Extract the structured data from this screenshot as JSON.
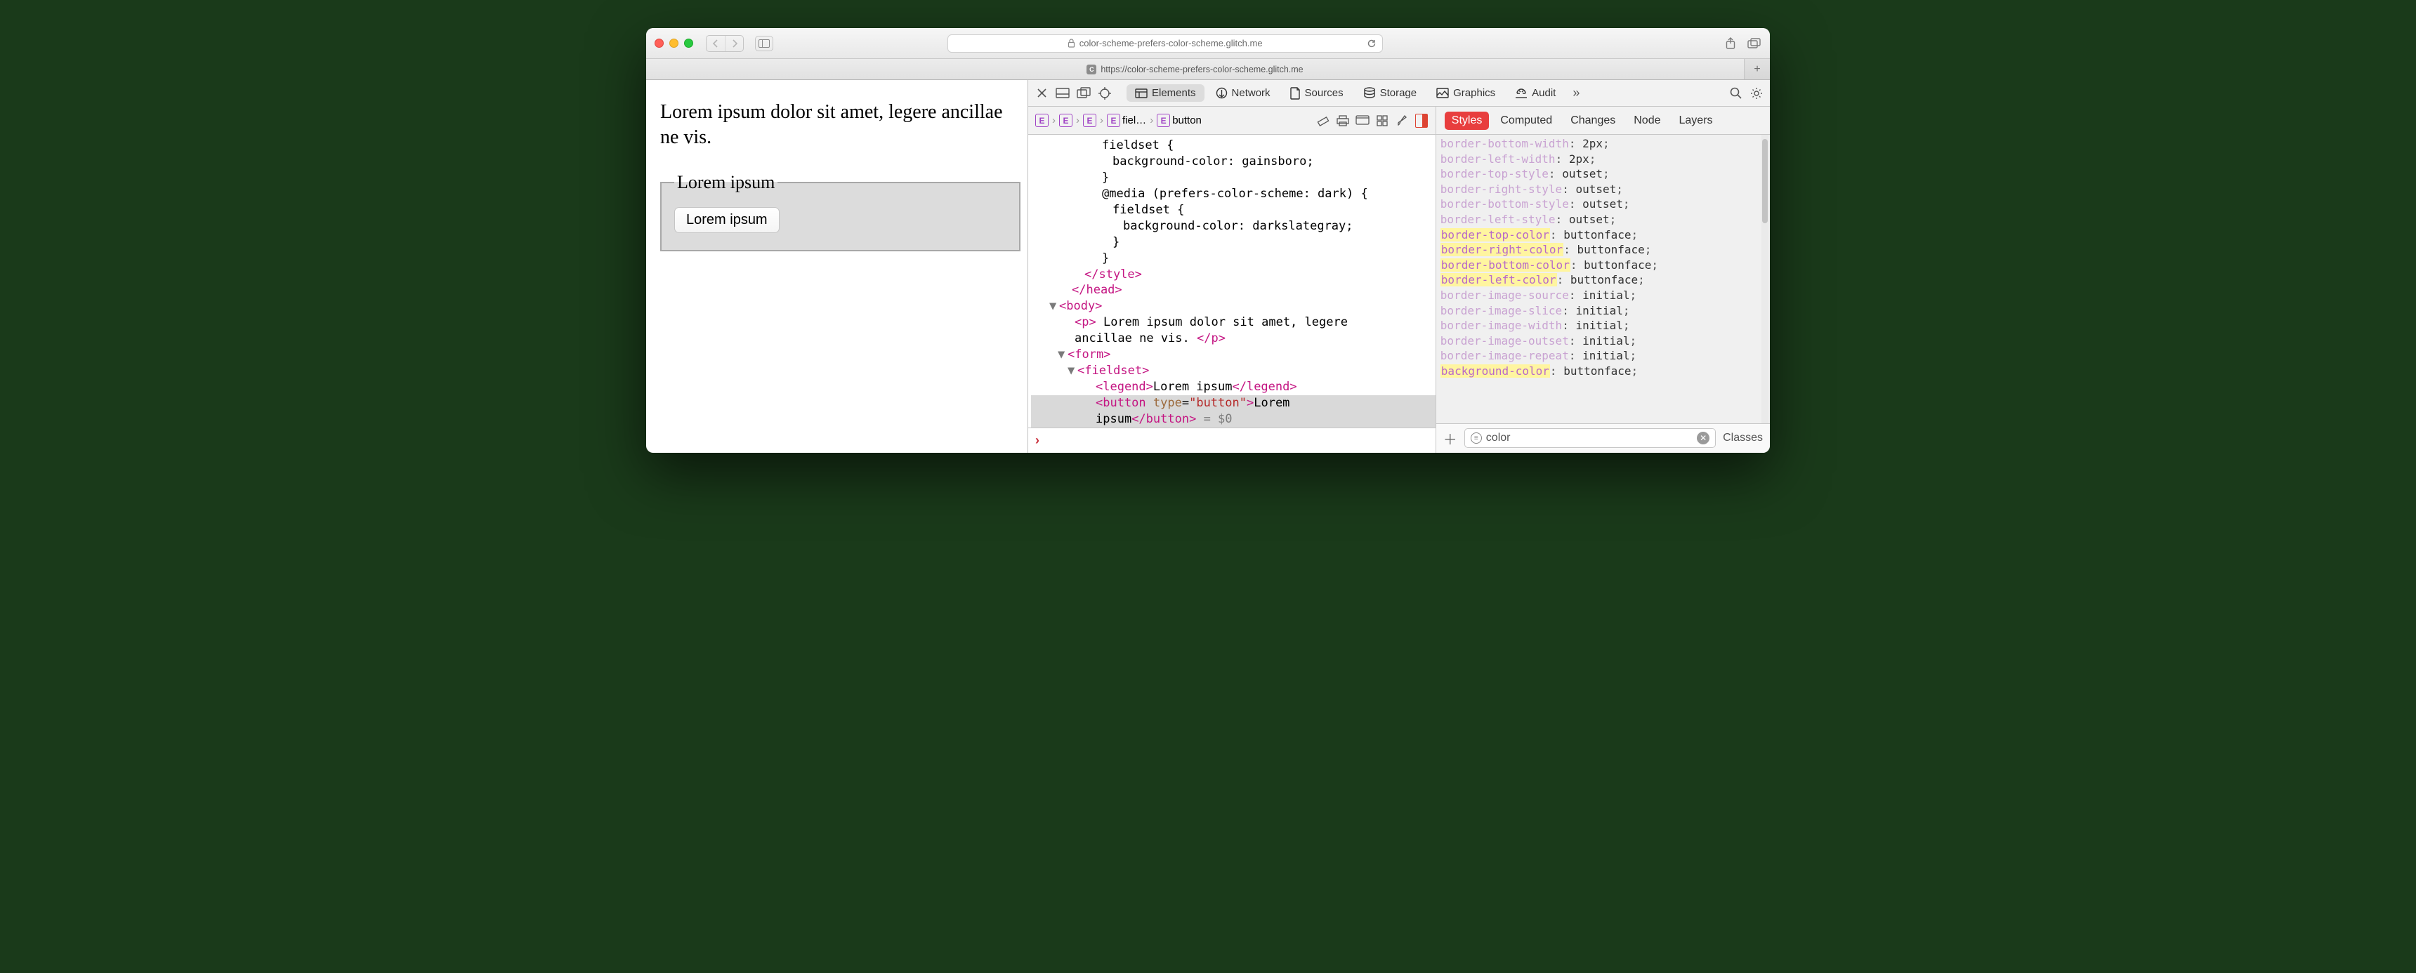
{
  "titlebar": {
    "url_display": "color-scheme-prefers-color-scheme.glitch.me",
    "lock_icon": "lock-icon"
  },
  "tabbar": {
    "tab_label": "https://color-scheme-prefers-color-scheme.glitch.me",
    "favicon_letter": "C"
  },
  "page": {
    "paragraph": "Lorem ipsum dolor sit amet, legere ancillae ne vis.",
    "legend": "Lorem ipsum",
    "button": "Lorem ipsum"
  },
  "devtools_tabs": {
    "elements": "Elements",
    "network": "Network",
    "sources": "Sources",
    "storage": "Storage",
    "graphics": "Graphics",
    "audit": "Audit"
  },
  "breadcrumb": {
    "fieldset_label": "fiel…",
    "button_label": "button"
  },
  "source_lines": [
    {
      "indent": 95,
      "html": "<span class='txt'>fieldset {</span>"
    },
    {
      "indent": 110,
      "html": "<span class='txt'>background-color: gainsboro;</span>"
    },
    {
      "indent": 95,
      "html": "<span class='txt'>}</span>"
    },
    {
      "indent": 95,
      "html": "<span class='txt'>@media (prefers-color-scheme: dark) {</span>"
    },
    {
      "indent": 110,
      "html": "<span class='txt'>fieldset {</span>"
    },
    {
      "indent": 125,
      "html": "<span class='txt'>background-color: darkslategray;</span>"
    },
    {
      "indent": 110,
      "html": "<span class='txt'>}</span>"
    },
    {
      "indent": 95,
      "html": "<span class='txt'>}</span>"
    },
    {
      "indent": 70,
      "html": "<span class='tag'>&lt;/style&gt;</span>"
    },
    {
      "indent": 52,
      "html": "<span class='tag'>&lt;/head&gt;</span>"
    },
    {
      "indent": 36,
      "disc": "▼",
      "html": "<span class='tag'>&lt;body&gt;</span>"
    },
    {
      "indent": 56,
      "html": "<span class='tag'>&lt;p&gt;</span><span class='txt'> Lorem ipsum dolor sit amet, legere </span>"
    },
    {
      "indent": 56,
      "html": "<span class='txt'>ancillae ne vis. </span><span class='tag'>&lt;/p&gt;</span>"
    },
    {
      "indent": 48,
      "disc": "▼",
      "html": "<span class='tag'>&lt;form&gt;</span>"
    },
    {
      "indent": 62,
      "disc": "▼",
      "html": "<span class='tag'>&lt;fieldset&gt;</span>"
    },
    {
      "indent": 86,
      "html": "<span class='tag'>&lt;legend&gt;</span><span class='txt'>Lorem ipsum</span><span class='tag'>&lt;/legend&gt;</span>"
    },
    {
      "indent": 86,
      "sel": true,
      "html": "<span class='tag'>&lt;button </span><span class='attr'>type</span><span class='txt'>=</span><span class='attrval'>\"button\"</span><span class='tag'>&gt;</span><span class='txt'>Lorem </span>"
    },
    {
      "indent": 86,
      "sel": true,
      "html": "<span class='txt'>ipsum</span><span class='tag'>&lt;/button&gt;</span> <span class='gray'>= $0</span>"
    }
  ],
  "styles_tabs": {
    "styles": "Styles",
    "computed": "Computed",
    "changes": "Changes",
    "node": "Node",
    "layers": "Layers"
  },
  "style_props": [
    {
      "name": "border-bottom-width",
      "value": "2px",
      "faded": true,
      "hl": false
    },
    {
      "name": "border-left-width",
      "value": "2px",
      "faded": true,
      "hl": false
    },
    {
      "name": "border-top-style",
      "value": "outset",
      "faded": true,
      "hl": false
    },
    {
      "name": "border-right-style",
      "value": "outset",
      "faded": true,
      "hl": false
    },
    {
      "name": "border-bottom-style",
      "value": "outset",
      "faded": true,
      "hl": false
    },
    {
      "name": "border-left-style",
      "value": "outset",
      "faded": true,
      "hl": false
    },
    {
      "name": "border-top-color",
      "value": "buttonface",
      "faded": false,
      "hl": true
    },
    {
      "name": "border-right-color",
      "value": "buttonface",
      "faded": false,
      "hl": true
    },
    {
      "name": "border-bottom-color",
      "value": "buttonface",
      "faded": false,
      "hl": true
    },
    {
      "name": "border-left-color",
      "value": "buttonface",
      "faded": false,
      "hl": true
    },
    {
      "name": "border-image-source",
      "value": "initial",
      "faded": true,
      "hl": false
    },
    {
      "name": "border-image-slice",
      "value": "initial",
      "faded": true,
      "hl": false
    },
    {
      "name": "border-image-width",
      "value": "initial",
      "faded": true,
      "hl": false
    },
    {
      "name": "border-image-outset",
      "value": "initial",
      "faded": true,
      "hl": false
    },
    {
      "name": "border-image-repeat",
      "value": "initial",
      "faded": true,
      "hl": false
    },
    {
      "name": "background-color",
      "value": "buttonface",
      "faded": false,
      "hl": true
    }
  ],
  "styles_footer": {
    "filter_value": "color",
    "classes_label": "Classes"
  }
}
